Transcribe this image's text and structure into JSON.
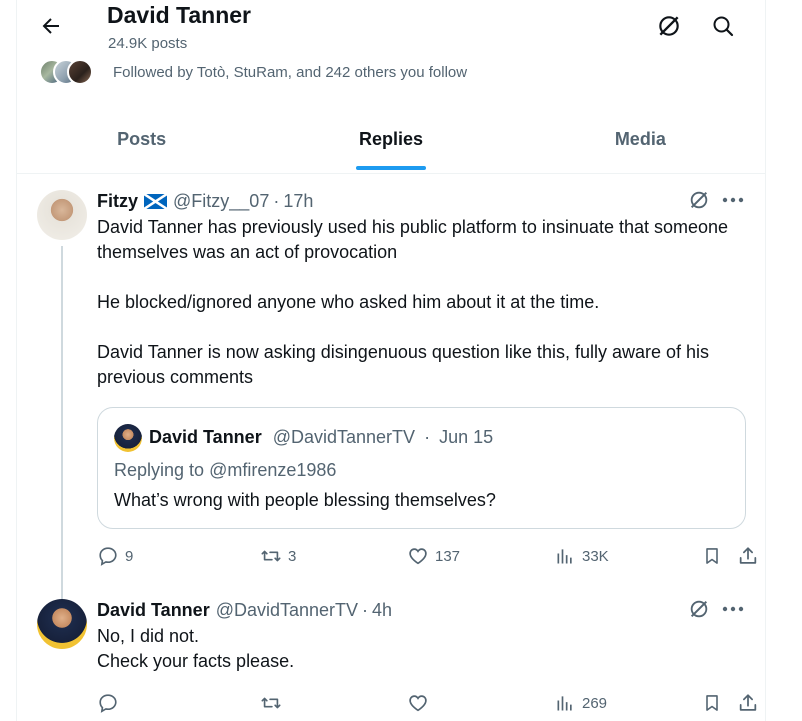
{
  "header": {
    "profile_name": "David Tanner",
    "post_count": "24.9K posts",
    "followed_by": "Followed by Totò, StuRam, and 242 others you follow"
  },
  "tabs": [
    {
      "label": "Posts",
      "active": false
    },
    {
      "label": "Replies",
      "active": true
    },
    {
      "label": "Media",
      "active": false
    }
  ],
  "accent_color": "#1d9bf0",
  "tweets": [
    {
      "name": "Fitzy",
      "flag_icon": "scotland-flag-icon",
      "handle": "@Fitzy__07",
      "time": "17h",
      "paragraphs": [
        "David Tanner has previously used his public platform to insinuate that someone themselves was an act of provocation",
        "He blocked/ignored anyone who asked him about it at the time.",
        "David Tanner is now asking disingenuous question like this, fully aware of his previous comments"
      ],
      "quote": {
        "name": "David Tanner",
        "handle": "@DavidTannerTV",
        "time": "Jun 15",
        "replying_to_prefix": "Replying to",
        "replying_to": "@mfirenze1986",
        "text": "What’s wrong with people blessing themselves?"
      },
      "stats": {
        "replies": "9",
        "reposts": "3",
        "likes": "137",
        "views": "33K"
      }
    },
    {
      "name": "David Tanner",
      "handle": "@DavidTannerTV",
      "time": "4h",
      "lines": [
        "No, I did not.",
        "Check your facts please."
      ],
      "stats": {
        "replies": "",
        "reposts": "",
        "likes": "",
        "views": "269"
      }
    }
  ]
}
